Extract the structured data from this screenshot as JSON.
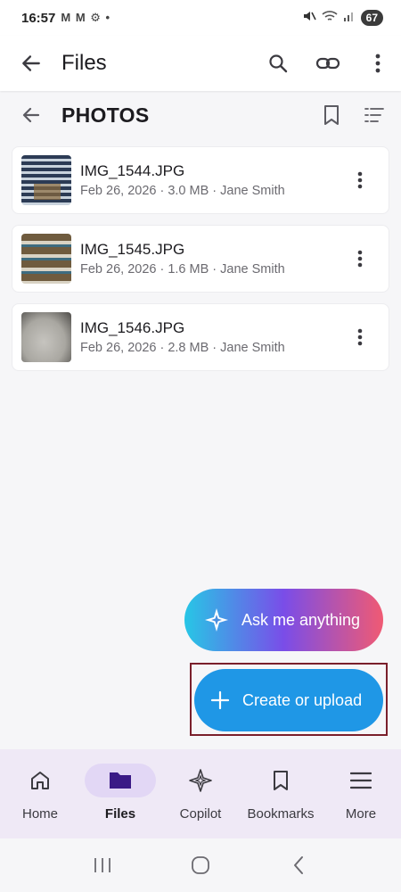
{
  "status_bar": {
    "time": "16:57",
    "notifications": "M M ⚙ •",
    "battery": "67"
  },
  "app_bar": {
    "title": "Files"
  },
  "folder": {
    "title": "PHOTOS"
  },
  "files": [
    {
      "name": "IMG_1544.JPG",
      "meta": "Feb 26, 2026 · 3.0 MB · Jane Smith"
    },
    {
      "name": "IMG_1545.JPG",
      "meta": "Feb 26, 2026 · 1.6 MB · Jane Smith"
    },
    {
      "name": "IMG_1546.JPG",
      "meta": "Feb 26, 2026 · 2.8 MB · Jane Smith"
    }
  ],
  "fabs": {
    "ask_label": "Ask me anything",
    "upload_label": "Create or upload"
  },
  "bottom_nav": {
    "items": [
      {
        "label": "Home"
      },
      {
        "label": "Files"
      },
      {
        "label": "Copilot"
      },
      {
        "label": "Bookmarks"
      },
      {
        "label": "More"
      }
    ]
  },
  "colors": {
    "accent_blue": "#1f97e6",
    "nav_active_bg": "#e2d7f5",
    "folder_icon": "#3a1a86"
  }
}
